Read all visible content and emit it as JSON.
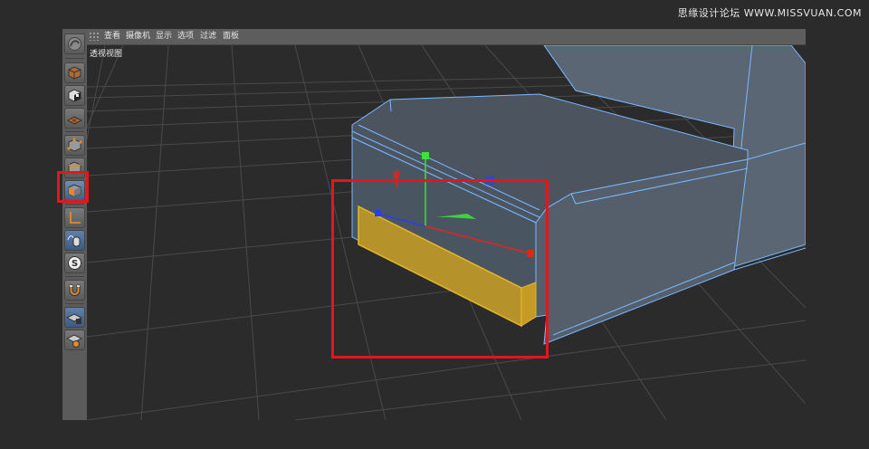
{
  "watermark": "思缘设计论坛 WWW.MISSVUAN.COM",
  "menu": {
    "items": [
      "查看",
      "摄像机",
      "显示",
      "选项",
      "过滤",
      "面板"
    ]
  },
  "viewport": {
    "label": "透视视图"
  },
  "toolbar": {
    "tools": [
      "object-mode-icon",
      "texture-mode-icon",
      "workplane-mode-icon",
      "points-mode-icon",
      "edges-mode-icon",
      "polygons-mode-icon",
      "axis-mode-icon",
      "tweak-mode-icon",
      "snap-icon",
      "magnet-icon",
      "workplane-lock-icon",
      "planar-workplane-icon"
    ],
    "active_tool": "polygons-mode-icon"
  },
  "colors": {
    "highlight": "#e4151c",
    "selection": "#e3b62a",
    "wire": "#7ab8ff",
    "x_axis": "#e2241c",
    "y_axis": "#3fe03a",
    "z_axis": "#2c3df0"
  }
}
